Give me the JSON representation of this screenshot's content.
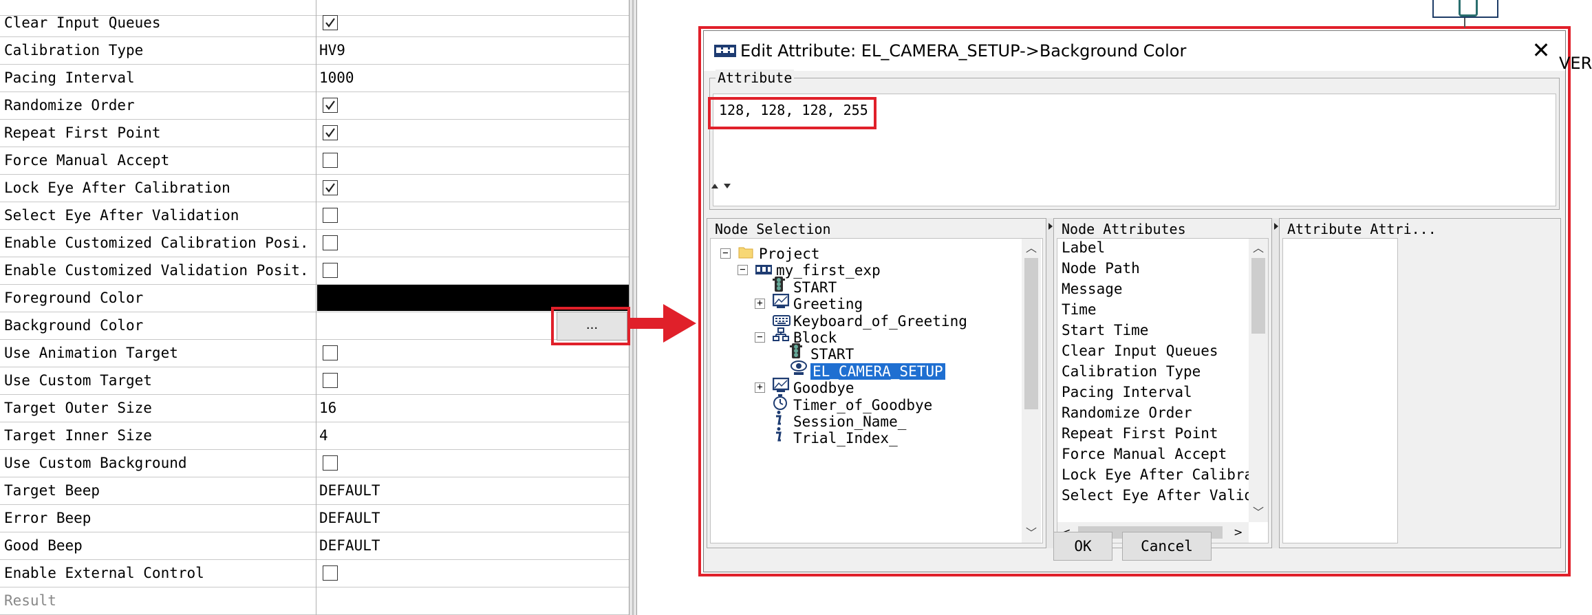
{
  "properties": [
    {
      "label": "Clear Input Queues",
      "type": "checkbox",
      "checked": true
    },
    {
      "label": "Calibration Type",
      "type": "text",
      "value": "HV9"
    },
    {
      "label": "Pacing Interval",
      "type": "text",
      "value": "1000"
    },
    {
      "label": "Randomize Order",
      "type": "checkbox",
      "checked": true
    },
    {
      "label": "Repeat First Point",
      "type": "checkbox",
      "checked": true
    },
    {
      "label": "Force Manual Accept",
      "type": "checkbox",
      "checked": false
    },
    {
      "label": "Lock Eye After Calibration",
      "type": "checkbox",
      "checked": true
    },
    {
      "label": "Select Eye After Validation",
      "type": "checkbox",
      "checked": false
    },
    {
      "label": "Enable Customized Calibration Posi...",
      "type": "checkbox",
      "checked": false
    },
    {
      "label": "Enable Customized Validation Posit...",
      "type": "checkbox",
      "checked": false
    },
    {
      "label": "Foreground Color",
      "type": "color",
      "color": "#000000"
    },
    {
      "label": "Background Color",
      "type": "button",
      "value": "..."
    },
    {
      "label": "Use Animation Target",
      "type": "checkbox",
      "checked": false
    },
    {
      "label": "Use Custom Target",
      "type": "checkbox",
      "checked": false
    },
    {
      "label": "Target Outer Size",
      "type": "text",
      "value": "16"
    },
    {
      "label": "Target Inner Size",
      "type": "text",
      "value": "4"
    },
    {
      "label": "Use Custom Background",
      "type": "checkbox",
      "checked": false
    },
    {
      "label": "Target Beep",
      "type": "text",
      "value": "DEFAULT"
    },
    {
      "label": "Error Beep",
      "type": "text",
      "value": "DEFAULT"
    },
    {
      "label": "Good Beep",
      "type": "text",
      "value": "DEFAULT"
    },
    {
      "label": "Enable External Control",
      "type": "checkbox",
      "checked": false
    },
    {
      "label": "Result",
      "type": "text",
      "value": ""
    }
  ],
  "dialog": {
    "title": "Edit Attribute: EL_CAMERA_SETUP->Background Color",
    "close_label": "✕",
    "attribute_group_title": "Attribute",
    "attribute_value": "128, 128, 128, 255",
    "node_selection_title": "Node Selection",
    "node_attributes_title": "Node Attributes",
    "attribute_attributes_title": "Attribute Attri...",
    "tree": [
      {
        "label": "Project",
        "icon": "folder-icon",
        "expander": "-"
      },
      {
        "label": "my_first_exp",
        "icon": "experiment-icon",
        "expander": "-"
      },
      {
        "label": "START",
        "icon": "traffic-light-icon",
        "expander": ""
      },
      {
        "label": "Greeting",
        "icon": "display-screen-icon",
        "expander": "+"
      },
      {
        "label": "Keyboard_of_Greeting",
        "icon": "keyboard-icon",
        "expander": ""
      },
      {
        "label": "Block",
        "icon": "block-sequence-icon",
        "expander": "-"
      },
      {
        "label": "START",
        "icon": "traffic-light-icon",
        "expander": ""
      },
      {
        "label": "EL_CAMERA_SETUP",
        "icon": "eye-camera-icon",
        "expander": "",
        "selected": true
      },
      {
        "label": "Goodbye",
        "icon": "display-screen-icon",
        "expander": "+"
      },
      {
        "label": "Timer_of_Goodbye",
        "icon": "timer-icon",
        "expander": ""
      },
      {
        "label": "Session_Name_",
        "icon": "info-icon",
        "expander": ""
      },
      {
        "label": "Trial_Index_",
        "icon": "info-icon",
        "expander": ""
      }
    ],
    "node_attributes": [
      "Label",
      "Node Path",
      "Message",
      "Time",
      "Start Time",
      "Clear Input Queues",
      "Calibration Type",
      "Pacing Interval",
      "Randomize Order",
      "Repeat First Point",
      "Force Manual Accept",
      "Lock Eye After Calibration",
      "Select Eye After Validation"
    ],
    "ok_label": "OK",
    "cancel_label": "Cancel"
  },
  "background_partial_text": "VER",
  "colors": {
    "highlight_red": "#e0202a",
    "selection_blue": "#1f6fd1"
  }
}
